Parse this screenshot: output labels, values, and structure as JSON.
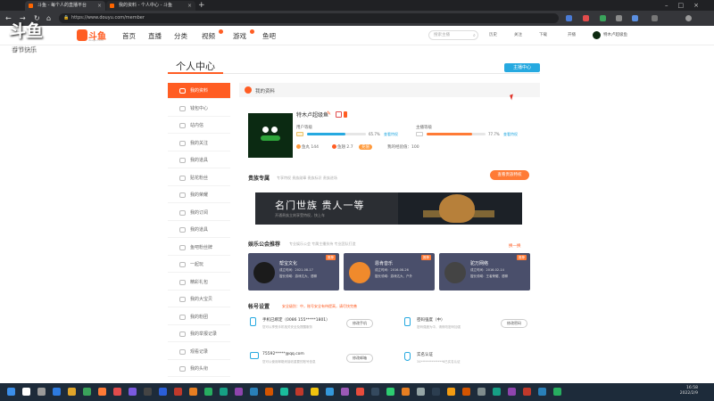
{
  "browser": {
    "tabs": [
      {
        "title": "斗鱼 - 每个人的直播平台"
      },
      {
        "title": "我的资料 - 个人中心 - 斗鱼"
      }
    ],
    "url": "https://www.douyu.com/member"
  },
  "watermark": {
    "brand": "斗鱼",
    "sub": "春节快乐"
  },
  "header": {
    "nav": [
      "首页",
      "直播",
      "分类",
      "视频",
      "游戏",
      "鱼吧"
    ],
    "search_placeholder": "搜索主播",
    "actions": [
      "历史",
      "关注",
      "下载",
      "开播"
    ],
    "username": "特木卢超级鱼"
  },
  "page_title": "个人中心",
  "anchor_center": "主播中心",
  "sidebar": [
    "我的资料",
    "钱包中心",
    "站内信",
    "我的关注",
    "我的道具",
    "贴花粉丝",
    "我的荣耀",
    "我的订阅",
    "我的道具",
    "鱼吧粉丝牌",
    "一起玩",
    "精彩礼包",
    "我的大宝贝",
    "我的粉团",
    "我的举报记录",
    "观看记录",
    "我的头衔"
  ],
  "profile": {
    "section": "我的资料",
    "name": "特木卢超级鱼",
    "user_level_label": "用户等级",
    "user_level_pct": "65.7%",
    "user_level_link": "查看特权",
    "user_level_fill": 0.657,
    "anchor_level_label": "主播等级",
    "anchor_level_pct": "77.7%",
    "anchor_level_link": "查看特权",
    "anchor_level_fill": 0.777,
    "yuwan": "鱼丸 144",
    "yuchi": "鱼翅 2.7",
    "recharge": "充值",
    "activity": "我的经验值：100"
  },
  "fans": {
    "title": "贵族专属",
    "sub": "专享特权 贵族勋章 贵族标识 贵族进场",
    "button": "查看贵族特权",
    "banner_title": "名门世族 贵人一等",
    "banner_sub": "开通贵族立刻享受特权，快上车"
  },
  "guilds": {
    "title": "娱乐公会推荐",
    "more": "换一换",
    "items": [
      {
        "name": "帮宝文化",
        "date": "成立时间：2021-08-17",
        "desc": "擅长领域：游戏达大、语聊",
        "tag": "推荐"
      },
      {
        "name": "恩肯音乐",
        "date": "成立时间：2016-08-26",
        "desc": "擅长领域：游戏达大、户外",
        "tag": "推荐"
      },
      {
        "name": "驼万网络",
        "date": "成立时间：2016-02-14",
        "desc": "擅长领域：王者荣耀、语聊",
        "tag": "推荐"
      }
    ]
  },
  "security": {
    "title": "帐号设置",
    "tip": "安全级别：中，账号安全有待提高，请尽快完善",
    "rows": [
      {
        "title": "手机已绑定（0086 155*****1801）",
        "desc": "您可以享受手机相关安全及提醒服务",
        "button": "修改手机"
      },
      {
        "title": "密码强度（中）",
        "desc": "密码强度为中，请修改密码加强",
        "button": "修改密码"
      },
      {
        "title": "75592*****@qq.com",
        "desc": "您可以使用邮箱来接收重要的账号信息",
        "button": "修改邮箱"
      },
      {
        "title": "实名认证",
        "desc": "34**************6已实名认证",
        "button": ""
      }
    ]
  },
  "taskbar": {
    "time": "16:58",
    "date": "2022/2/9"
  }
}
